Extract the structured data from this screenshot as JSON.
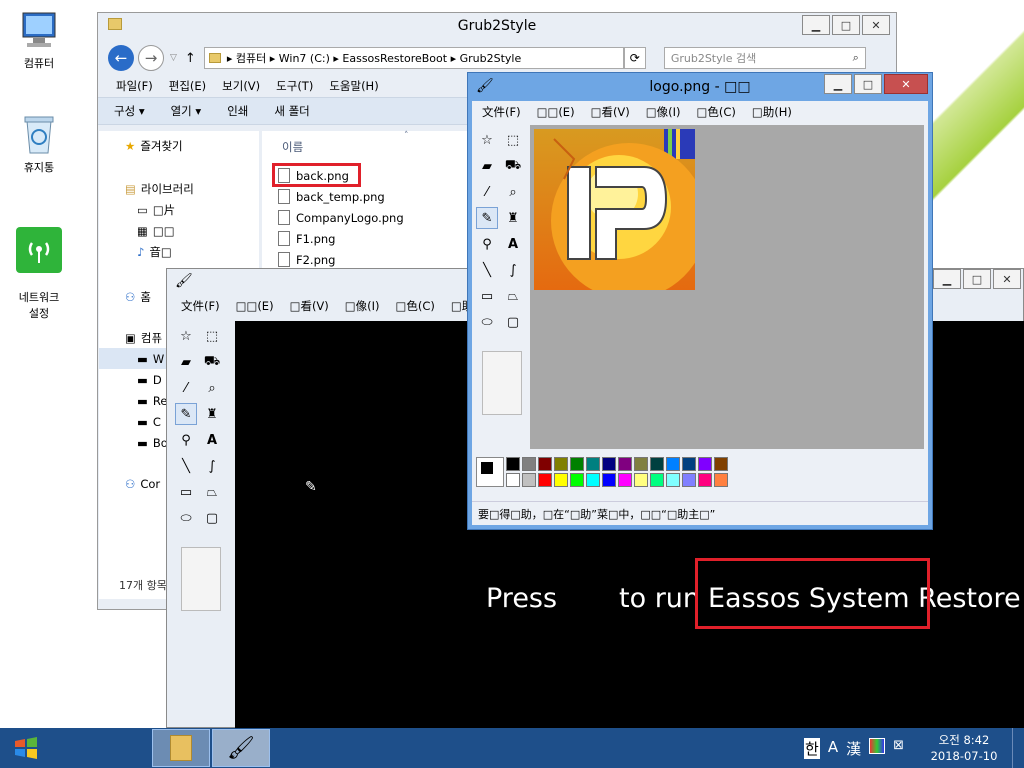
{
  "desktop": {
    "icons": [
      {
        "label": "컴퓨터",
        "icon": "computer-icon"
      },
      {
        "label": "휴지통",
        "icon": "recycle-bin-icon"
      },
      {
        "label": "네트워크\n설정",
        "icon": "network-settings-icon"
      }
    ]
  },
  "explorer": {
    "title": "Grub2Style",
    "breadcrumb": [
      "컴퓨터",
      "Win7 (C:)",
      "EassosRestoreBoot",
      "Grub2Style"
    ],
    "search_placeholder": "Grub2Style 검색",
    "menu": [
      "파일(F)",
      "편집(E)",
      "보기(V)",
      "도구(T)",
      "도움말(H)"
    ],
    "toolbar": [
      "구성 ▾",
      "열기 ▾",
      "인쇄",
      "새 폴더"
    ],
    "column_header": "이름",
    "nav": {
      "favorites": "즐겨찾기",
      "libraries": "라이브러리",
      "lib_items": [
        "□片",
        "□□",
        "音□"
      ],
      "homegroup": "홈",
      "computer": "컴퓨",
      "drives": [
        "W",
        "D",
        "Re",
        "C",
        "Bo"
      ],
      "network": "Cor"
    },
    "files": [
      "back.png",
      "back_temp.png",
      "CompanyLogo.png",
      "F1.png",
      "F2.png"
    ],
    "status": "17개 항목"
  },
  "paint_back": {
    "menu": [
      "文件(F)",
      "□□(E)",
      "□看(V)",
      "□像(I)",
      "□色(C)",
      "□助"
    ],
    "text_press": "Press",
    "text_to": "to run",
    "text_app": "Eassos System Restore"
  },
  "paint_logo": {
    "title": "logo.png - □□",
    "menu": [
      "文件(F)",
      "□□(E)",
      "□看(V)",
      "□像(I)",
      "□色(C)",
      "□助(H)"
    ],
    "status": "要□得□助，□在“□助”菜□中，□□“□助主□”",
    "palette_top": [
      "#000000",
      "#808080",
      "#800000",
      "#808000",
      "#008000",
      "#008080",
      "#000080",
      "#800080",
      "#808040",
      "#004040",
      "#0080ff",
      "#004080",
      "#8000ff",
      "#804000"
    ],
    "palette_bottom": [
      "#ffffff",
      "#c0c0c0",
      "#ff0000",
      "#ffff00",
      "#00ff00",
      "#00ffff",
      "#0000ff",
      "#ff00ff",
      "#ffff80",
      "#00ff80",
      "#80ffff",
      "#8080ff",
      "#ff0080",
      "#ff8040"
    ]
  },
  "taskbar": {
    "tray_ime": "한",
    "tray_a": "A",
    "tray_han": "漢",
    "time": "오전 8:42",
    "date": "2018-07-10"
  },
  "colors": {
    "highlight": "#e0202a",
    "taskbar": "#1e4f8a",
    "paint_frame": "#6ea6e4"
  }
}
